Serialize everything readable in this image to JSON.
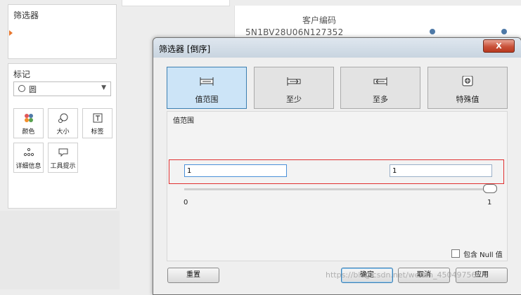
{
  "filters_panel": {
    "title": "筛选器"
  },
  "marks_panel": {
    "title": "标记",
    "mark_type": "圆",
    "cards": [
      {
        "label": "颜色",
        "icon": "color-dots-icon"
      },
      {
        "label": "大小",
        "icon": "size-icon"
      },
      {
        "label": "标签",
        "icon": "label-T-icon"
      },
      {
        "label": "详细信息",
        "icon": "detail-dots-icon"
      },
      {
        "label": "工具提示",
        "icon": "tooltip-icon"
      }
    ]
  },
  "sheet": {
    "column_header": "客户编码",
    "row_value": "5N1BV28U06N127352"
  },
  "dialog": {
    "title": "筛选器 [倒序]",
    "close_label": "X",
    "tabs": [
      {
        "label": "值范围",
        "icon": "range-icon",
        "selected": true
      },
      {
        "label": "至少",
        "icon": "at-least-icon",
        "selected": false
      },
      {
        "label": "至多",
        "icon": "at-most-icon",
        "selected": false
      },
      {
        "label": "特殊值",
        "icon": "special-value-icon",
        "selected": false
      }
    ],
    "section_label": "值范围",
    "min_value": "1",
    "max_value": "1",
    "scale_min": "0",
    "scale_max": "1",
    "include_null_label": "包含 Null 值",
    "include_null_checked": false,
    "buttons": {
      "reset": "重置",
      "ok": "确定",
      "cancel": "取消",
      "apply": "应用"
    }
  },
  "watermark": "https://blog.csdn.net/weixin_45049756",
  "colors": {
    "accent": "#3c7fb1",
    "highlight_box": "#e03030",
    "close": "#c9523a"
  }
}
